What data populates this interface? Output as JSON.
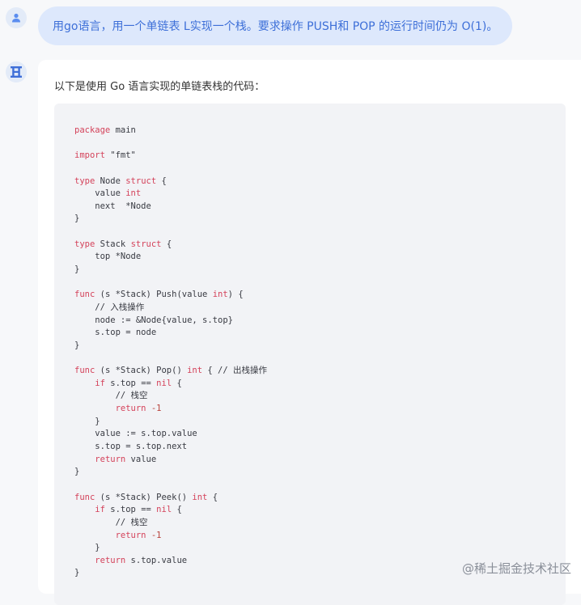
{
  "user_message": {
    "text": "用go语言，用一个单链表 L实现一个栈。要求操作 PUSH和 POP 的运行时间仍为 O(1)。"
  },
  "assistant": {
    "intro": "以下是使用 Go 语言实现的单链表栈的代码：",
    "code_lines": [
      [
        {
          "t": "package",
          "c": "kw"
        },
        {
          "t": " main"
        }
      ],
      [],
      [
        {
          "t": "import",
          "c": "kw"
        },
        {
          "t": " \"fmt\""
        }
      ],
      [],
      [
        {
          "t": "type",
          "c": "kw"
        },
        {
          "t": " Node "
        },
        {
          "t": "struct",
          "c": "kw"
        },
        {
          "t": " {"
        }
      ],
      [
        {
          "t": "    value "
        },
        {
          "t": "int",
          "c": "kw"
        }
      ],
      [
        {
          "t": "    next  *Node"
        }
      ],
      [
        {
          "t": "}"
        }
      ],
      [],
      [
        {
          "t": "type",
          "c": "kw"
        },
        {
          "t": " Stack "
        },
        {
          "t": "struct",
          "c": "kw"
        },
        {
          "t": " {"
        }
      ],
      [
        {
          "t": "    top *Node"
        }
      ],
      [
        {
          "t": "}"
        }
      ],
      [],
      [
        {
          "t": "func",
          "c": "kw"
        },
        {
          "t": " (s *Stack) Push(value "
        },
        {
          "t": "int",
          "c": "kw"
        },
        {
          "t": ") {"
        }
      ],
      [
        {
          "t": "    // 入栈操作"
        }
      ],
      [
        {
          "t": "    node := &Node{value, s.top}"
        }
      ],
      [
        {
          "t": "    s.top = node"
        }
      ],
      [
        {
          "t": "}"
        }
      ],
      [],
      [
        {
          "t": "func",
          "c": "kw"
        },
        {
          "t": " (s *Stack) Pop() "
        },
        {
          "t": "int",
          "c": "kw"
        },
        {
          "t": " { // 出栈操作"
        }
      ],
      [
        {
          "t": "    "
        },
        {
          "t": "if",
          "c": "kw"
        },
        {
          "t": " s.top == "
        },
        {
          "t": "nil",
          "c": "kw"
        },
        {
          "t": " {"
        }
      ],
      [
        {
          "t": "        // 栈空"
        }
      ],
      [
        {
          "t": "        "
        },
        {
          "t": "return",
          "c": "kw"
        },
        {
          "t": " "
        },
        {
          "t": "-1",
          "c": "num"
        }
      ],
      [
        {
          "t": "    }"
        }
      ],
      [
        {
          "t": "    value := s.top.value"
        }
      ],
      [
        {
          "t": "    s.top = s.top.next"
        }
      ],
      [
        {
          "t": "    "
        },
        {
          "t": "return",
          "c": "kw"
        },
        {
          "t": " value"
        }
      ],
      [
        {
          "t": "}"
        }
      ],
      [],
      [
        {
          "t": "func",
          "c": "kw"
        },
        {
          "t": " (s *Stack) Peek() "
        },
        {
          "t": "int",
          "c": "kw"
        },
        {
          "t": " {"
        }
      ],
      [
        {
          "t": "    "
        },
        {
          "t": "if",
          "c": "kw"
        },
        {
          "t": " s.top == "
        },
        {
          "t": "nil",
          "c": "kw"
        },
        {
          "t": " {"
        }
      ],
      [
        {
          "t": "        // 栈空"
        }
      ],
      [
        {
          "t": "        "
        },
        {
          "t": "return",
          "c": "kw"
        },
        {
          "t": " "
        },
        {
          "t": "-1",
          "c": "num"
        }
      ],
      [
        {
          "t": "    }"
        }
      ],
      [
        {
          "t": "    "
        },
        {
          "t": "return",
          "c": "kw"
        },
        {
          "t": " s.top.value"
        }
      ],
      [
        {
          "t": "}"
        }
      ]
    ]
  },
  "watermark": {
    "text": "@稀土掘金技术社区"
  },
  "icons": {
    "user": "user-icon",
    "bot": "bot-logo-icon"
  },
  "colors": {
    "user_text": "#3d6fd8",
    "user_bubble": "#dde8fc",
    "keyword": "#d4425a"
  }
}
